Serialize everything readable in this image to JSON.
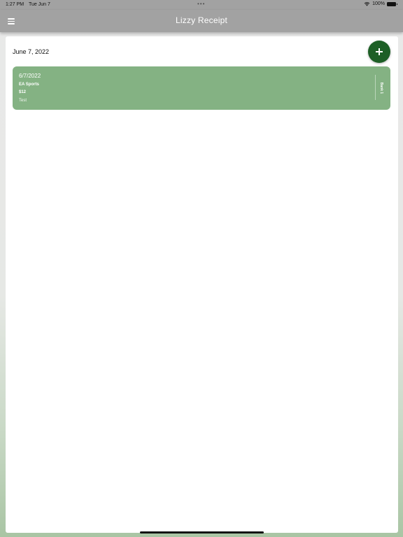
{
  "status_bar": {
    "time": "1:27 PM",
    "date": "Tue Jun 7",
    "battery": "100%"
  },
  "header": {
    "title": "Lizzy Receipt"
  },
  "section": {
    "date": "June 7, 2022"
  },
  "receipts": [
    {
      "date": "6/7/2022",
      "vendor": "EA Sports",
      "amount": "$12",
      "note": "Test",
      "tag": "Bank 1"
    }
  ],
  "colors": {
    "header_bg": "#a2a2a2",
    "card_bg": "#84b283",
    "accent": "#1d5f26"
  },
  "icons": {
    "menu": "hamburger-icon",
    "add": "plus-icon",
    "wifi": "wifi-icon",
    "battery": "battery-icon"
  }
}
